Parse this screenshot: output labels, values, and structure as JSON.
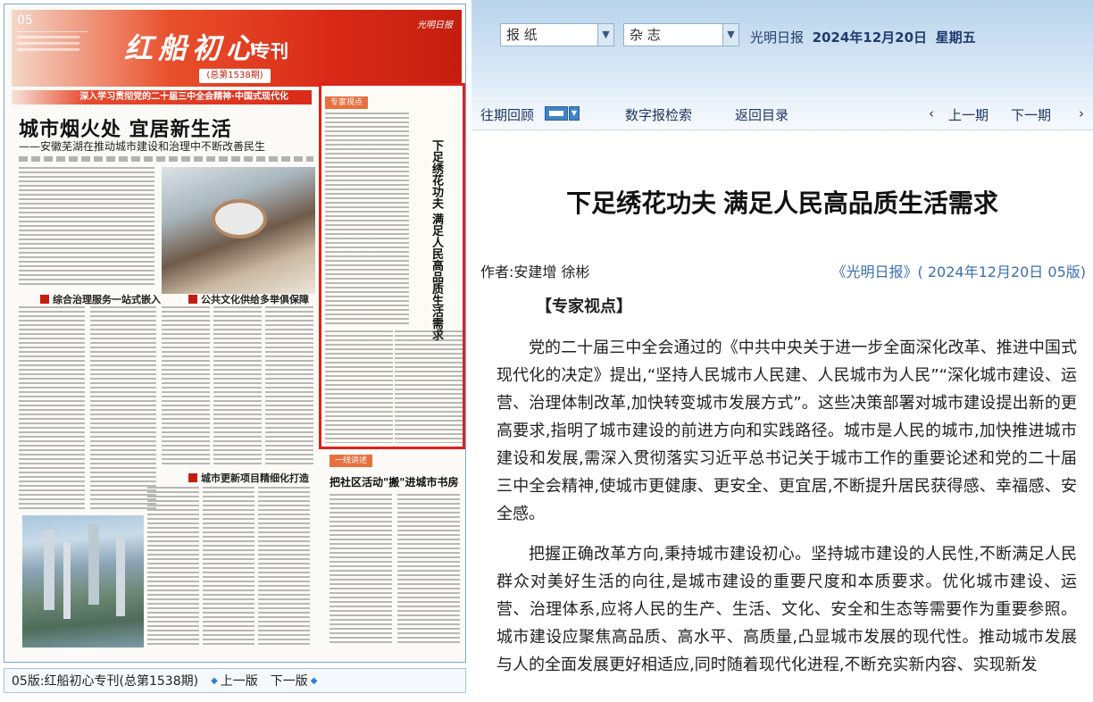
{
  "paper_page": {
    "page_number": "05",
    "masthead_title": "红船初心",
    "masthead_suffix": "专刊",
    "issue": "(总第1538期)",
    "paper_logo": "光明日报",
    "banner": "深入学习贯彻党的二十届三中全会精神·中国式现代化",
    "headline": "城市烟火处  宜居新生活",
    "subheadline": "——安徽芜湖在推动城市建设和治理中不断改善民生",
    "section_1": "综合治理服务一站式嵌入",
    "section_2": "公共文化供给多举俱保障",
    "section_3": "城市更新项目精细化打造",
    "expert_tag": "专家视点",
    "expert_vertical_title": "下足绣花功夫 满足人民高品质生活需求",
    "yiti_tag": "一线讲述",
    "yiti_title": "把社区活动\"搬\"进城市书房"
  },
  "caption": {
    "label": "05版:红船初心专刊(总第1538期)",
    "prev": "上一版",
    "next": "下一版"
  },
  "topbar": {
    "select_newspaper": "报    纸",
    "select_magazine": "杂    志",
    "paper_name": "光明日报",
    "date": "2024年12月20日",
    "weekday": "星期五"
  },
  "nav": {
    "back_issues": "往期回顾",
    "search": "数字报检索",
    "back_to_index": "返回目录",
    "prev_issue": "上一期",
    "next_issue": "下一期"
  },
  "article": {
    "title": "下足绣花功夫 满足人民高品质生活需求",
    "author": "作者:安建增 徐彬",
    "source": "《光明日报》( 2024年12月20日   05版)",
    "lead": "【专家视点】",
    "paragraphs": [
      "党的二十届三中全会通过的《中共中央关于进一步全面深化改革、推进中国式现代化的决定》提出,“坚持人民城市人民建、人民城市为人民”“深化城市建设、运营、治理体制改革,加快转变城市发展方式”。这些决策部署对城市建设提出新的更高要求,指明了城市建设的前进方向和实践路径。城市是人民的城市,加快推进城市建设和发展,需深入贯彻落实习近平总书记关于城市工作的重要论述和党的二十届三中全会精神,使城市更健康、更安全、更宜居,不断提升居民获得感、幸福感、安全感。",
      "把握正确改革方向,秉持城市建设初心。坚持城市建设的人民性,不断满足人民群众对美好生活的向往,是城市建设的重要尺度和本质要求。优化城市建设、运营、治理体系,应将人民的生产、生活、文化、安全和生态等需要作为重要参照。城市建设应聚焦高品质、高水平、高质量,凸显城市发展的现代性。推动城市发展与人的全面发展更好相适应,同时随着现代化进程,不断充实新内容、实现新发"
    ]
  },
  "icons": [
    "calendar-icon",
    "chevron-left-icon",
    "chevron-right-icon",
    "diamond-left-icon",
    "diamond-right-icon",
    "dropdown-arrow-icon"
  ],
  "colors": {
    "accent_red": "#d92b17",
    "frame_blue": "#7aa7d6",
    "link_blue": "#3a6fb6",
    "nav_text": "#1e3763"
  }
}
